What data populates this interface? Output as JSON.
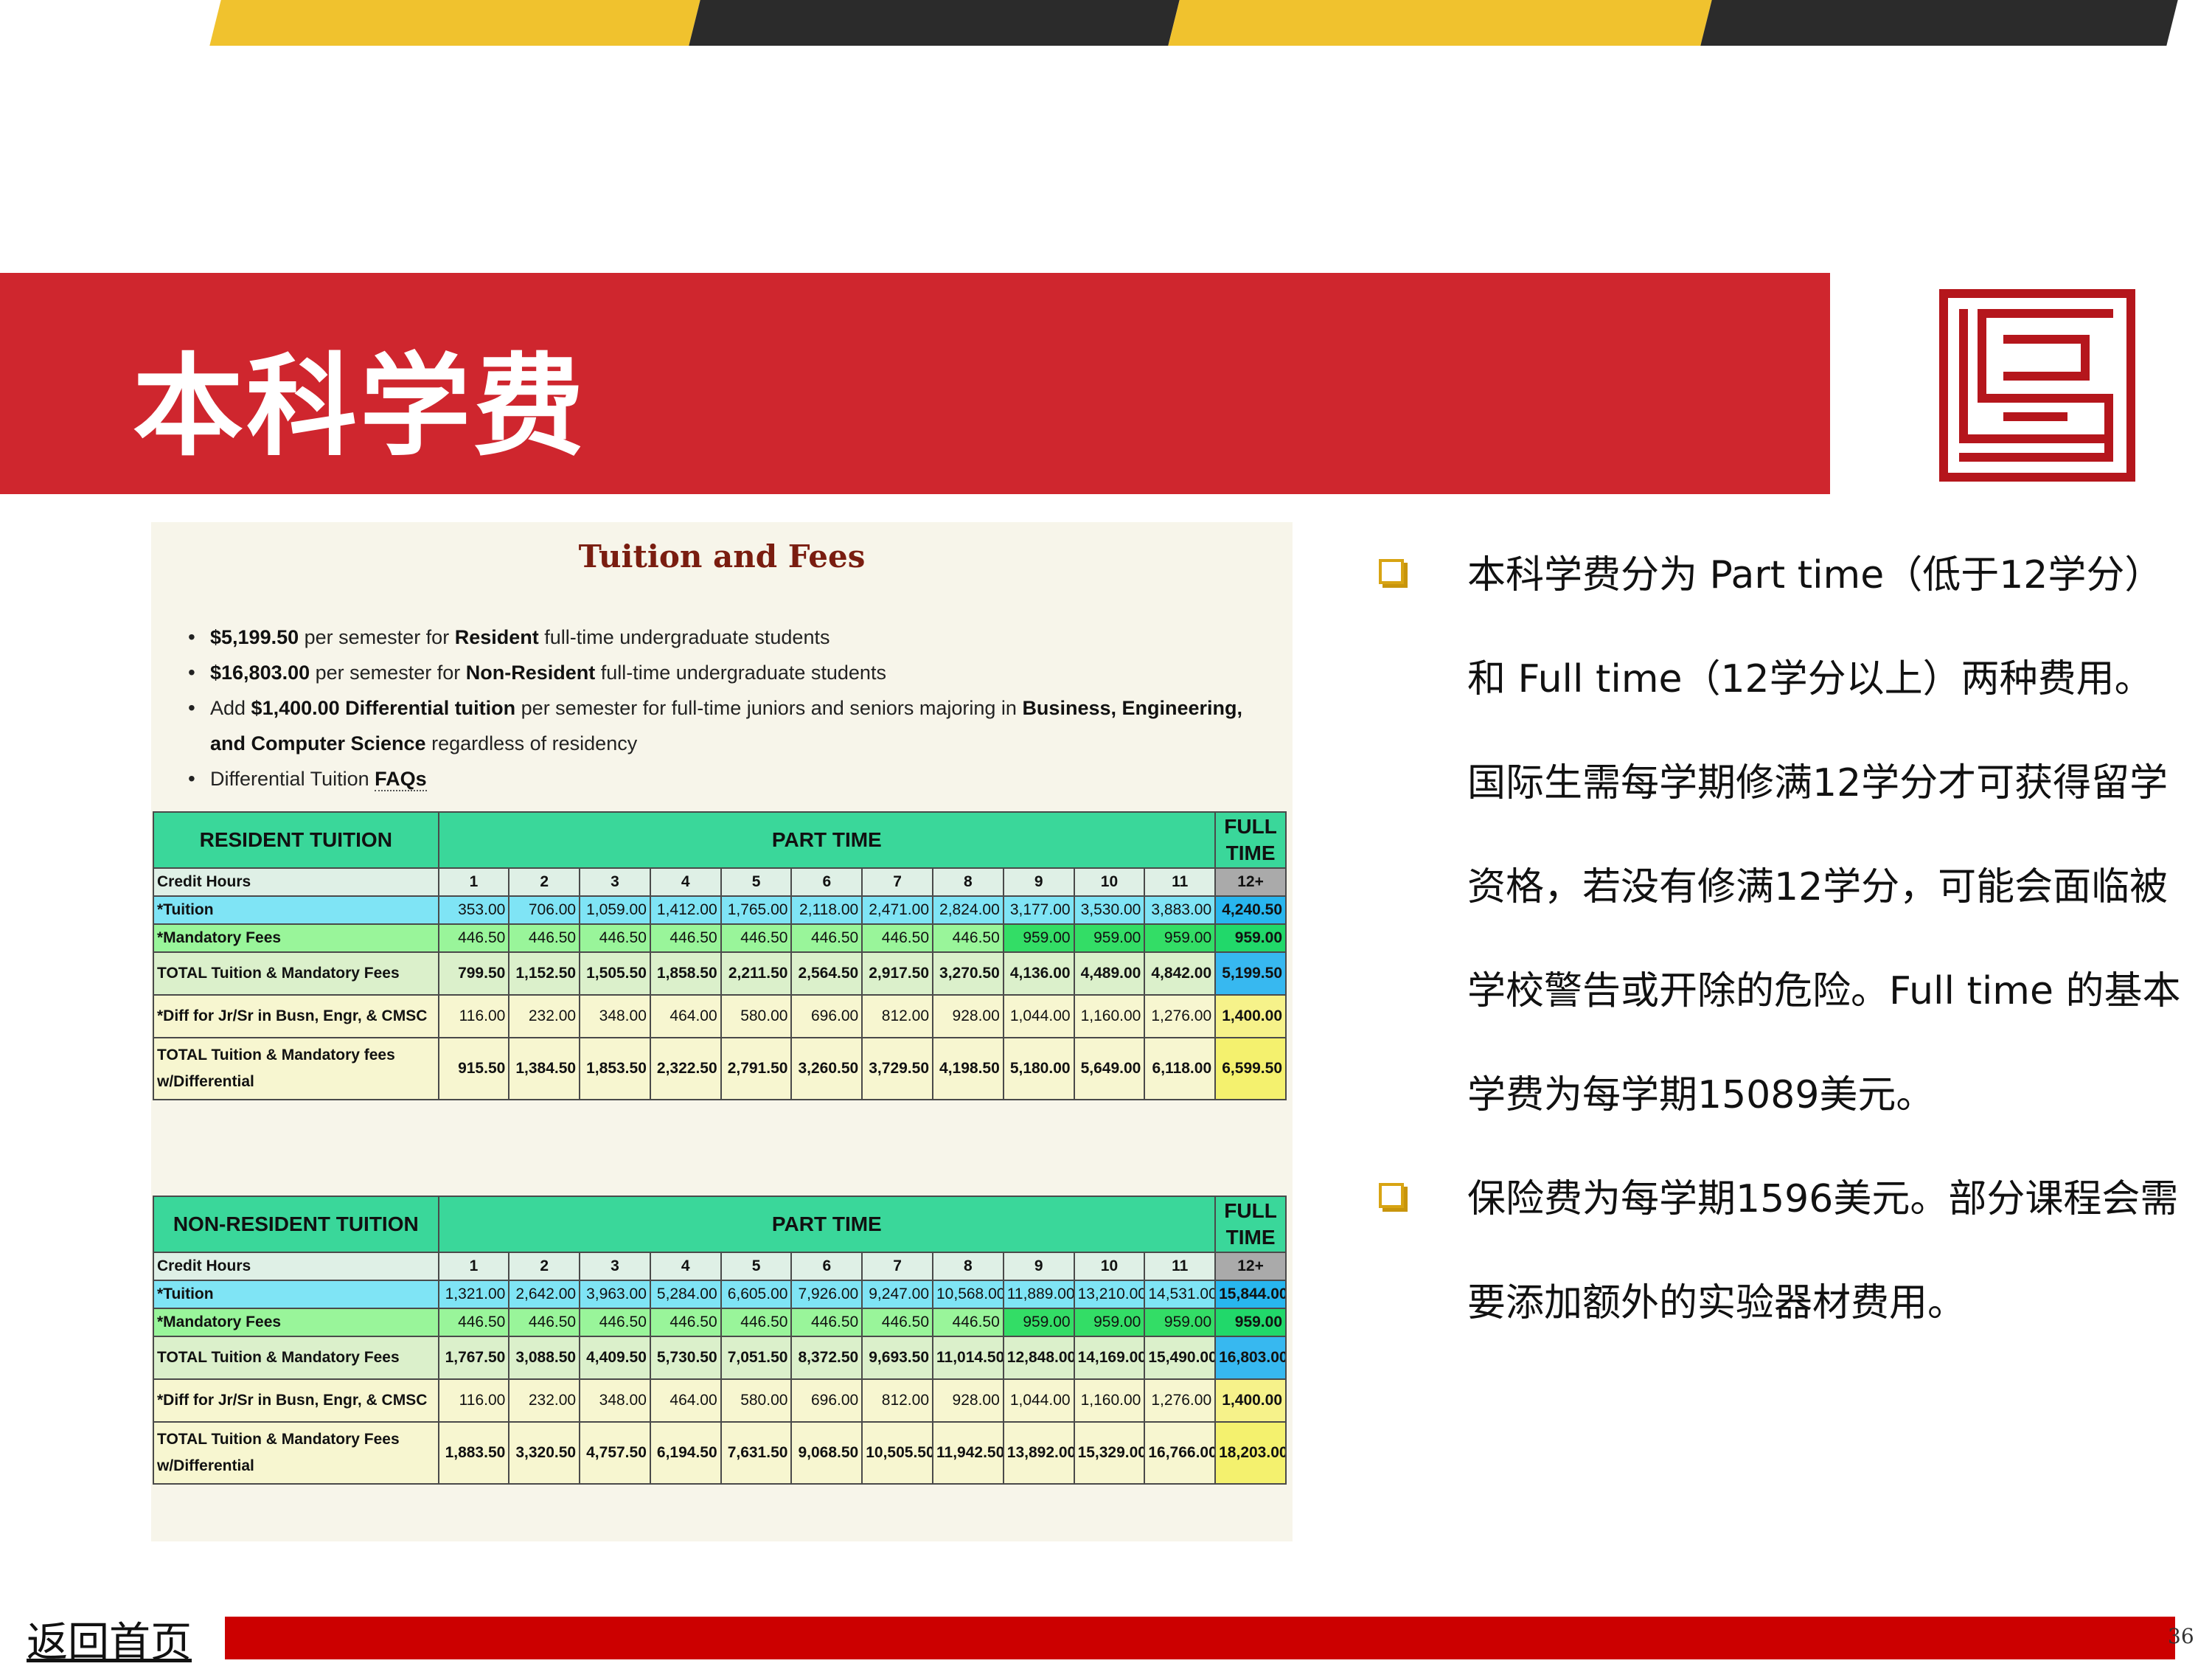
{
  "slide": {
    "title": "本科学费",
    "home_link": "返回首页",
    "page_number": "36",
    "colors": {
      "accent_red": "#cf262e",
      "stripe_yellow": "#f0c22e",
      "stripe_dark": "#2b2b2b",
      "footer_red": "#cc0000"
    }
  },
  "doc": {
    "title": "Tuition and Fees",
    "bullets": [
      {
        "b1": "$5,199.50",
        "t1": " per semester for ",
        "b2": "Resident",
        "t2": " full-time undergraduate students"
      },
      {
        "b1": "$16,803.00",
        "t1": " per semester for ",
        "b2": "Non-Resident",
        "t2": " full-time undergraduate students"
      },
      {
        "t0": "Add ",
        "b1": "$1,400.00 Differential tuition",
        "t1": " per semester for full-time juniors and seniors majoring in ",
        "b2": "Business, Engineering, and Computer Science",
        "t2": " regardless of residency"
      },
      {
        "t0": "Differential Tuition ",
        "b1": "FAQs"
      }
    ]
  },
  "tables": [
    {
      "header_left": "RESIDENT TUITION",
      "header_mid": "PART TIME",
      "header_right": "FULL TIME",
      "credit_label": "Credit Hours",
      "credits": [
        "1",
        "2",
        "3",
        "4",
        "5",
        "6",
        "7",
        "8",
        "9",
        "10",
        "11",
        "12+"
      ],
      "rows": [
        {
          "label": "*Tuition",
          "values": [
            "353.00",
            "706.00",
            "1,059.00",
            "1,412.00",
            "1,765.00",
            "2,118.00",
            "2,471.00",
            "2,824.00",
            "3,177.00",
            "3,530.00",
            "3,883.00",
            "4,240.50"
          ]
        },
        {
          "label": "*Mandatory Fees",
          "values": [
            "446.50",
            "446.50",
            "446.50",
            "446.50",
            "446.50",
            "446.50",
            "446.50",
            "446.50",
            "959.00",
            "959.00",
            "959.00",
            "959.00"
          ]
        },
        {
          "label": "TOTAL Tuition & Mandatory Fees",
          "values": [
            "799.50",
            "1,152.50",
            "1,505.50",
            "1,858.50",
            "2,211.50",
            "2,564.50",
            "2,917.50",
            "3,270.50",
            "4,136.00",
            "4,489.00",
            "4,842.00",
            "5,199.50"
          ]
        },
        {
          "label": "*Diff for Jr/Sr in Busn, Engr, & CMSC",
          "values": [
            "116.00",
            "232.00",
            "348.00",
            "464.00",
            "580.00",
            "696.00",
            "812.00",
            "928.00",
            "1,044.00",
            "1,160.00",
            "1,276.00",
            "1,400.00"
          ]
        },
        {
          "label": "TOTAL Tuition & Mandatory fees w/Differential",
          "values": [
            "915.50",
            "1,384.50",
            "1,853.50",
            "2,322.50",
            "2,791.50",
            "3,260.50",
            "3,729.50",
            "4,198.50",
            "5,180.00",
            "5,649.00",
            "6,118.00",
            "6,599.50"
          ]
        }
      ]
    },
    {
      "header_left": "NON-RESIDENT TUITION",
      "header_mid": "PART TIME",
      "header_right": "FULL TIME",
      "credit_label": "Credit Hours",
      "credits": [
        "1",
        "2",
        "3",
        "4",
        "5",
        "6",
        "7",
        "8",
        "9",
        "10",
        "11",
        "12+"
      ],
      "rows": [
        {
          "label": "*Tuition",
          "values": [
            "1,321.00",
            "2,642.00",
            "3,963.00",
            "5,284.00",
            "6,605.00",
            "7,926.00",
            "9,247.00",
            "10,568.00",
            "11,889.00",
            "13,210.00",
            "14,531.00",
            "15,844.00"
          ]
        },
        {
          "label": "*Mandatory Fees",
          "values": [
            "446.50",
            "446.50",
            "446.50",
            "446.50",
            "446.50",
            "446.50",
            "446.50",
            "446.50",
            "959.00",
            "959.00",
            "959.00",
            "959.00"
          ]
        },
        {
          "label": "TOTAL Tuition & Mandatory Fees",
          "values": [
            "1,767.50",
            "3,088.50",
            "4,409.50",
            "5,730.50",
            "7,051.50",
            "8,372.50",
            "9,693.50",
            "11,014.50",
            "12,848.00",
            "14,169.00",
            "15,490.00",
            "16,803.00"
          ]
        },
        {
          "label": "*Diff for Jr/Sr in Busn, Engr, & CMSC",
          "values": [
            "116.00",
            "232.00",
            "348.00",
            "464.00",
            "580.00",
            "696.00",
            "812.00",
            "928.00",
            "1,044.00",
            "1,160.00",
            "1,276.00",
            "1,400.00"
          ]
        },
        {
          "label": "TOTAL Tuition & Mandatory Fees w/Differential",
          "values": [
            "1,883.50",
            "3,320.50",
            "4,757.50",
            "6,194.50",
            "7,631.50",
            "9,068.50",
            "10,505.50",
            "11,942.50",
            "13,892.00",
            "15,329.00",
            "16,766.00",
            "18,203.00"
          ]
        }
      ]
    }
  ],
  "notes": [
    "本科学费分为 Part time（低于12学分）和 Full time（12学分以上）两种费用。国际生需每学期修满12学分才可获得留学资格，若没有修满12学分，可能会面临被学校警告或开除的危险。Full time 的基本学费为每学期15089美元。",
    "保险费为每学期1596美元。部分课程会需要添加额外的实验器材费用。"
  ]
}
